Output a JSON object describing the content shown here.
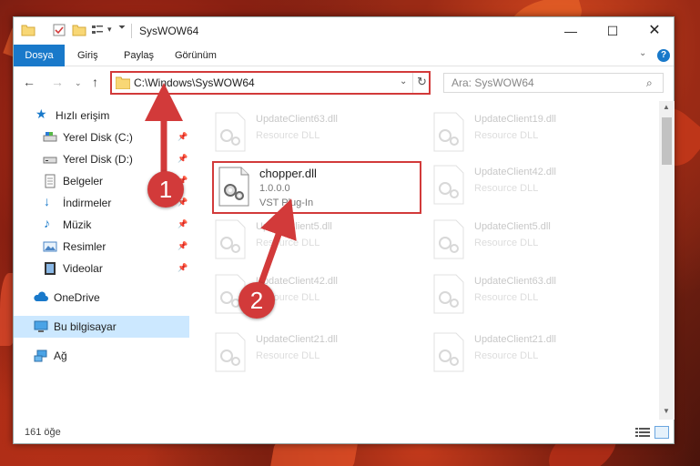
{
  "window": {
    "title": "SysWOW64",
    "min_symbol": "—",
    "max_symbol": "☐",
    "close_symbol": "✕"
  },
  "ribbon": {
    "tabs": [
      "Dosya",
      "Giriş",
      "Paylaş",
      "Görünüm"
    ],
    "help_symbol": "?",
    "collapse_symbol": "⌄"
  },
  "nav": {
    "back_symbol": "←",
    "forward_symbol": "→",
    "recent_symbol": "⌄",
    "up_symbol": "↑",
    "address": "C:\\Windows\\SysWOW64",
    "address_dropdown_symbol": "⌄",
    "refresh_symbol": "↻",
    "search_placeholder": "Ara: SysWOW64",
    "search_symbol": "⌕"
  },
  "sidebar": {
    "items": [
      {
        "label": "Hızlı erişim",
        "icon": "star-icon",
        "pinned": false,
        "selected": false
      },
      {
        "label": "Yerel Disk (C:)",
        "icon": "drive-icon",
        "pinned": true,
        "selected": false
      },
      {
        "label": "Yerel Disk (D:)",
        "icon": "drive-icon",
        "pinned": true,
        "selected": false
      },
      {
        "label": "Belgeler",
        "icon": "documents-icon",
        "pinned": true,
        "selected": false
      },
      {
        "label": "İndirmeler",
        "icon": "download-icon",
        "pinned": true,
        "selected": false
      },
      {
        "label": "Müzik",
        "icon": "music-icon",
        "pinned": true,
        "selected": false
      },
      {
        "label": "Resimler",
        "icon": "pictures-icon",
        "pinned": true,
        "selected": false
      },
      {
        "label": "Videolar",
        "icon": "videos-icon",
        "pinned": true,
        "selected": false
      },
      {
        "label": "OneDrive",
        "icon": "cloud-icon",
        "pinned": false,
        "selected": false
      },
      {
        "label": "Bu bilgisayar",
        "icon": "computer-icon",
        "pinned": false,
        "selected": true
      },
      {
        "label": "Ağ",
        "icon": "network-icon",
        "pinned": false,
        "selected": false
      }
    ],
    "pin_symbol": "📌"
  },
  "files": {
    "highlighted": {
      "name": "chopper.dll",
      "version": "1.0.0.0",
      "description": "VST Plug-In"
    },
    "faded": [
      {
        "name": "UpdateClient63.dll",
        "sub": "Resource DLL"
      },
      {
        "name": "UpdateClient19.dll",
        "sub": "Resource DLL"
      },
      {
        "name": "UpdateClient42.dll",
        "sub": "Resource DLL"
      },
      {
        "name": "UpdateClient5.dll",
        "sub": "Resource DLL"
      },
      {
        "name": "UpdateClient5.dll",
        "sub": "Resource DLL"
      },
      {
        "name": "UpdateClient42.dll",
        "sub": "Resource DLL"
      },
      {
        "name": "UpdateClient63.dll",
        "sub": "Resource DLL"
      },
      {
        "name": "UpdateClient21.dll",
        "sub": "Resource DLL"
      },
      {
        "name": "UpdateClient21.dll",
        "sub": "Resource DLL"
      }
    ]
  },
  "status": {
    "item_count": "161 öğe"
  },
  "callouts": [
    "1",
    "2"
  ],
  "colors": {
    "accent": "#1979ca",
    "highlight": "#d23a3a",
    "selected_bg": "#cce8ff"
  }
}
